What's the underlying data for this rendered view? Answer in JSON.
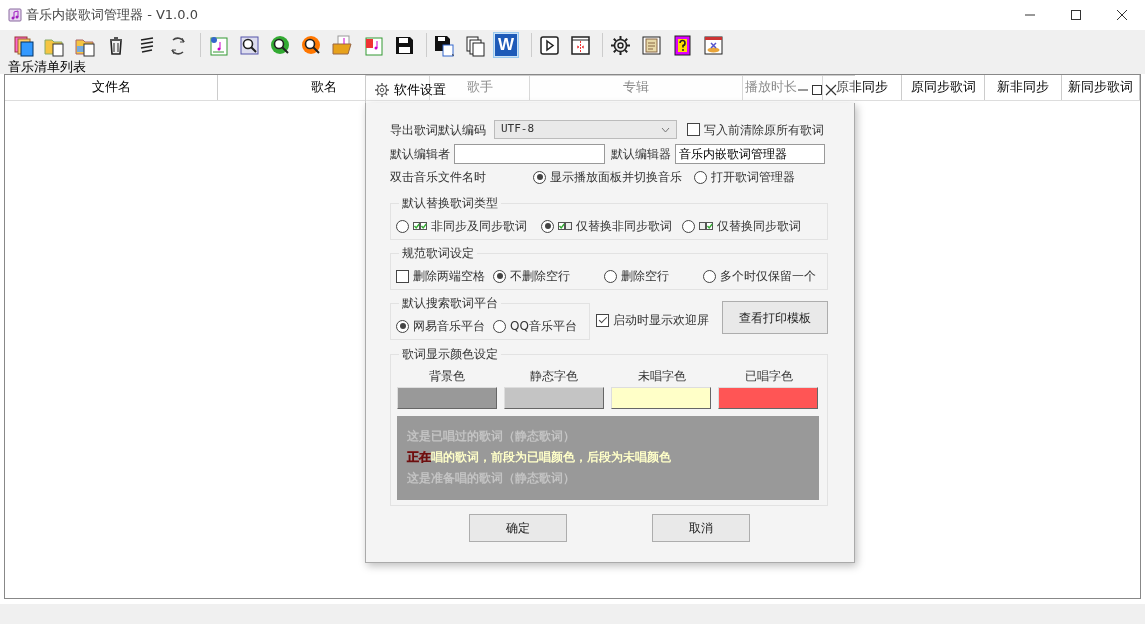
{
  "window": {
    "title": "音乐内嵌歌词管理器 - V1.0.0"
  },
  "toolbar": {
    "word_letter": "W"
  },
  "list_label": "音乐清单列表",
  "table": {
    "columns": [
      "文件名",
      "歌名",
      "歌手",
      "专辑",
      "播放时长",
      "原非同步",
      "原同步歌词",
      "新非同步",
      "新同步歌词"
    ]
  },
  "dialog": {
    "title": "软件设置",
    "encoding": {
      "label": "导出歌词默认编码",
      "value": "UTF-8"
    },
    "clear_before_write": {
      "label": "写入前清除原所有歌词",
      "checked": false
    },
    "editor_author": {
      "label": "默认编辑者"
    },
    "editor_program": {
      "label": "默认编辑器",
      "value": "音乐内嵌歌词管理器"
    },
    "double_click": {
      "label": "双击音乐文件名时",
      "options": [
        {
          "label": "显示播放面板并切换音乐",
          "selected": true
        },
        {
          "label": "打开歌词管理器",
          "selected": false
        }
      ]
    },
    "replace_type": {
      "title": "默认替换歌词类型",
      "options": [
        {
          "label": "非同步及同步歌词",
          "selected": false
        },
        {
          "label": "仅替换非同步歌词",
          "selected": true
        },
        {
          "label": "仅替换同步歌词",
          "selected": false
        }
      ]
    },
    "normalize": {
      "title": "规范歌词设定",
      "trim": {
        "label": "删除两端空格",
        "checked": false
      },
      "options": [
        {
          "label": "不删除空行",
          "selected": true
        },
        {
          "label": "删除空行",
          "selected": false
        },
        {
          "label": "多个时仅保留一个",
          "selected": false
        }
      ]
    },
    "search_platform": {
      "title": "默认搜索歌词平台",
      "options": [
        {
          "label": "网易音乐平台",
          "selected": true
        },
        {
          "label": "QQ音乐平台",
          "selected": false
        }
      ]
    },
    "welcome": {
      "label": "启动时显示欢迎屏",
      "checked": true
    },
    "print_template_button": "查看打印模板",
    "colors": {
      "title": "歌词显示颜色设定",
      "swatches": [
        {
          "label": "背景色",
          "color": "#999999"
        },
        {
          "label": "静态字色",
          "color": "#c4c4c4"
        },
        {
          "label": "未唱字色",
          "color": "#ffffc8"
        },
        {
          "label": "已唱字色",
          "color": "#ff5555"
        }
      ],
      "preview": [
        {
          "kind": "static",
          "text": "这是已唱过的歌词（静态歌词）"
        },
        {
          "kind": "current",
          "sung": "正在",
          "unsung": "唱的歌词，前段为已唱颜色，后段为未唱颜色"
        },
        {
          "kind": "static",
          "text": "这是准备唱的歌词（静态歌词）"
        }
      ]
    },
    "buttons": [
      "确定",
      "取消"
    ]
  }
}
